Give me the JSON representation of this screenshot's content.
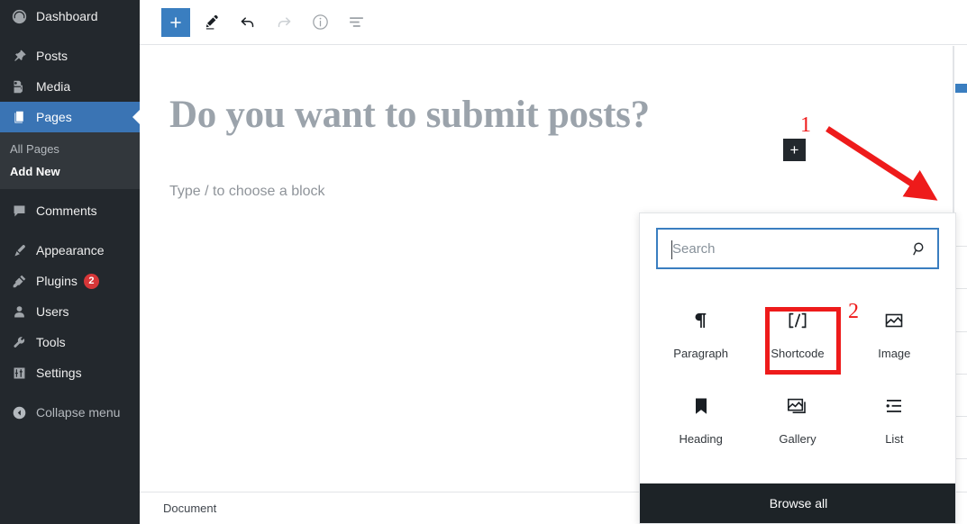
{
  "sidebar": {
    "items": [
      {
        "label": "Dashboard",
        "icon": "dashboard-icon",
        "current": false,
        "badge": null
      },
      {
        "label": "Posts",
        "icon": "pin-icon",
        "current": false,
        "badge": null
      },
      {
        "label": "Media",
        "icon": "media-icon",
        "current": false,
        "badge": null
      },
      {
        "label": "Pages",
        "icon": "pages-icon",
        "current": true,
        "badge": null
      },
      {
        "label": "Comments",
        "icon": "comment-icon",
        "current": false,
        "badge": null
      },
      {
        "label": "Appearance",
        "icon": "brush-icon",
        "current": false,
        "badge": null
      },
      {
        "label": "Plugins",
        "icon": "plugin-icon",
        "current": false,
        "badge": "2"
      },
      {
        "label": "Users",
        "icon": "user-icon",
        "current": false,
        "badge": null
      },
      {
        "label": "Tools",
        "icon": "wrench-icon",
        "current": false,
        "badge": null
      },
      {
        "label": "Settings",
        "icon": "sliders-icon",
        "current": false,
        "badge": null
      },
      {
        "label": "Collapse menu",
        "icon": "collapse-arrow-icon",
        "current": false,
        "badge": null
      }
    ],
    "submenu": [
      {
        "label": "All Pages",
        "current": false
      },
      {
        "label": "Add New",
        "current": true
      }
    ],
    "active_background": "#3a74b4",
    "background": "#23282d",
    "submenu_background": "#32373c",
    "badge_color": "#d63638"
  },
  "toolbar": {
    "add_block_label": "+",
    "buttons": [
      {
        "name": "add-block-button",
        "icon": "plus-icon"
      },
      {
        "name": "edit-mode-button",
        "icon": "pencil-icon"
      },
      {
        "name": "undo-button",
        "icon": "undo-arrow-icon"
      },
      {
        "name": "redo-button",
        "icon": "redo-arrow-icon"
      },
      {
        "name": "content-info-button",
        "icon": "info-circle-icon"
      },
      {
        "name": "block-navigation-button",
        "icon": "outline-list-icon"
      }
    ],
    "primary_color": "#3a7ec0"
  },
  "editor": {
    "post_title": "Do you want to submit posts?",
    "block_placeholder": "Type / to choose a block",
    "inline_inserter_label": "+"
  },
  "bottom_bar": {
    "breadcrumb": "Document"
  },
  "inserter": {
    "search": {
      "value": "",
      "placeholder": "Search",
      "icon": "search-icon"
    },
    "blocks": [
      {
        "label": "Paragraph",
        "icon": "paragraph-icon",
        "highlighted": false
      },
      {
        "label": "Shortcode",
        "icon": "shortcode-icon",
        "highlighted": true
      },
      {
        "label": "Image",
        "icon": "image-icon",
        "highlighted": false
      },
      {
        "label": "Heading",
        "icon": "heading-bookmark-icon",
        "highlighted": false
      },
      {
        "label": "Gallery",
        "icon": "gallery-icon",
        "highlighted": false
      },
      {
        "label": "List",
        "icon": "list-icon",
        "highlighted": false
      }
    ],
    "browse_all_label": "Browse all"
  },
  "annotations": {
    "color": "#ee1b1b",
    "markers": [
      {
        "label": "1",
        "target": "inline-inserter-button"
      },
      {
        "label": "2",
        "target": "shortcode-block"
      }
    ]
  }
}
